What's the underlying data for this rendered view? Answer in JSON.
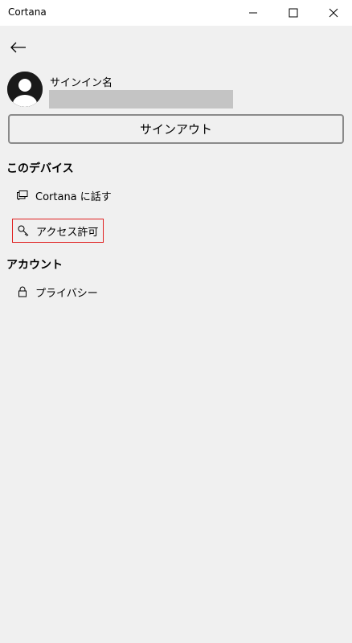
{
  "window": {
    "title": "Cortana"
  },
  "account": {
    "signin_label": "サインイン名",
    "signout_label": "サインアウト"
  },
  "sections": {
    "device": {
      "heading": "このデバイス",
      "items": [
        {
          "label": "Cortana に話す",
          "icon": "chat-icon"
        },
        {
          "label": "アクセス許可",
          "icon": "key-icon",
          "highlighted": true
        }
      ]
    },
    "account": {
      "heading": "アカウント",
      "items": [
        {
          "label": "プライバシー",
          "icon": "lock-icon"
        }
      ]
    }
  },
  "colors": {
    "background": "#f0f0f0",
    "titlebar": "#ffffff",
    "highlight_border": "#e02020",
    "redaction": "#c4c4c4"
  }
}
